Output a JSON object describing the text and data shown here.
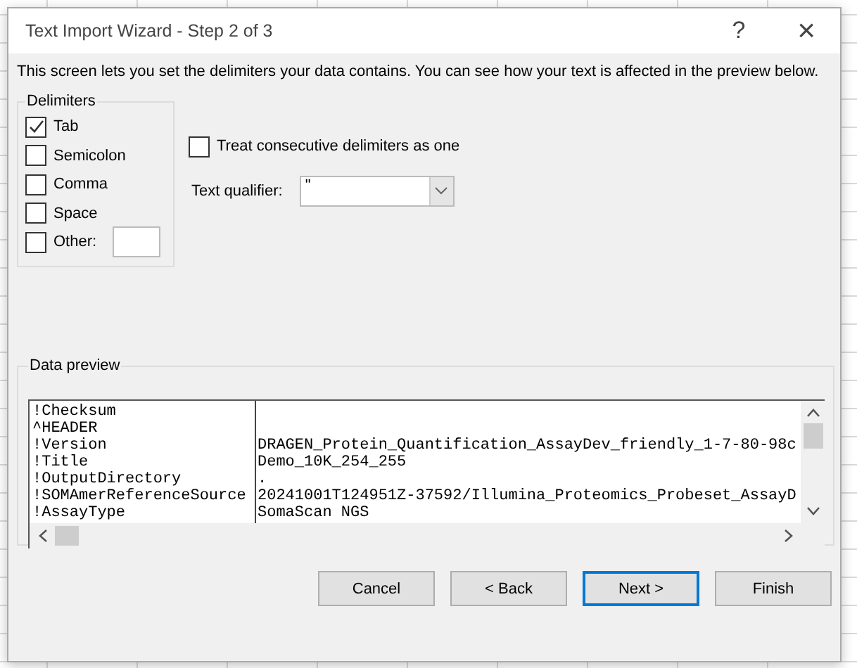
{
  "window": {
    "title": "Text Import Wizard - Step 2 of 3",
    "help": "?",
    "close": "×"
  },
  "intro": "This screen lets you set the delimiters your data contains.  You can see how your text is affected in the preview below.",
  "delimiters": {
    "title": "Delimiters",
    "options": [
      {
        "label": "Tab",
        "checked": true
      },
      {
        "label": "Semicolon",
        "checked": false
      },
      {
        "label": "Comma",
        "checked": false
      },
      {
        "label": "Space",
        "checked": false
      },
      {
        "label": "Other:",
        "checked": false,
        "kind": "with-field"
      }
    ]
  },
  "consecutive": {
    "label": "Treat consecutive delimiters as one",
    "checked": false
  },
  "qualifier": {
    "label": "Text qualifier:",
    "value": "\""
  },
  "preview": {
    "title": "Data preview",
    "rows": [
      [
        "!Checksum",
        ""
      ],
      [
        "^HEADER",
        ""
      ],
      [
        "!Version",
        "DRAGEN_Protein_Quantification_AssayDev_friendly_1-7-80-98c"
      ],
      [
        "!Title",
        "Demo_10K_254_255"
      ],
      [
        "!OutputDirectory",
        "."
      ],
      [
        "!SOMAmerReferenceSource",
        "20241001T124951Z-37592/Illumina_Proteomics_Probeset_AssayD"
      ],
      [
        "!AssayType",
        "SomaScan NGS"
      ]
    ]
  },
  "buttons": [
    {
      "label": "Cancel",
      "default": false
    },
    {
      "label": "< Back",
      "default": false
    },
    {
      "label": "Next >",
      "default": true
    },
    {
      "label": "Finish",
      "default": false
    }
  ]
}
